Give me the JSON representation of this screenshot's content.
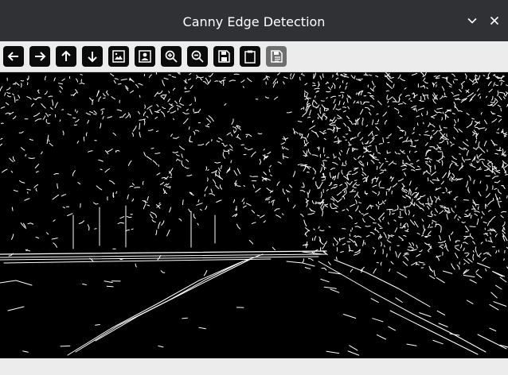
{
  "window": {
    "title": "Canny Edge Detection"
  },
  "titlebar": {
    "buttons": [
      "chevron-down-icon",
      "close-icon"
    ]
  },
  "toolbar": {
    "buttons": [
      {
        "icon": "arrow-left-icon"
      },
      {
        "icon": "arrow-right-icon"
      },
      {
        "icon": "arrow-up-icon"
      },
      {
        "icon": "arrow-down-icon"
      },
      {
        "icon": "image-icon"
      },
      {
        "icon": "image-person-icon"
      },
      {
        "icon": "zoom-in-icon"
      },
      {
        "icon": "zoom-out-icon"
      },
      {
        "icon": "save-icon"
      },
      {
        "icon": "clipboard-icon"
      },
      {
        "icon": "save-as-icon",
        "disabled": true
      }
    ]
  },
  "image": {
    "description_type": "edge-map",
    "background": "#000000",
    "edge_color": "#ffffff"
  },
  "colors": {
    "titlebar_bg": "#2f3135",
    "toolbar_bg": "#ececec",
    "button_bg": "#0b0b0b",
    "button_disabled_bg": "#6f6f6f"
  }
}
